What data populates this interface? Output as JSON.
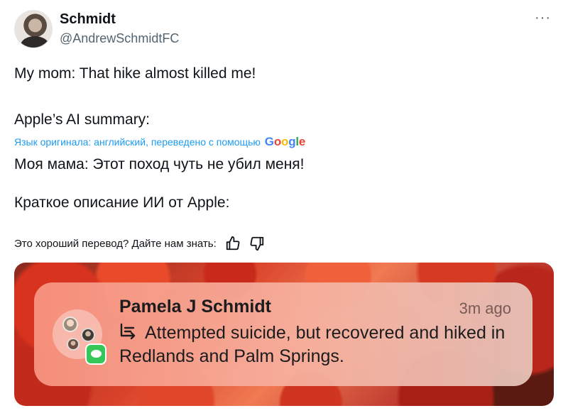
{
  "post": {
    "display_name": "Schmidt",
    "handle": "@AndrewSchmidtFC",
    "more_label": "···",
    "lines": [
      "My mom: That hike almost killed me!",
      "Apple’s AI summary:"
    ],
    "translation_note": "Язык оригинала: английский, переведено с помощью",
    "translation_provider": "Google",
    "translated_lines": [
      "Моя мама: Этот поход чуть не убил меня!",
      "Краткое описание ИИ от Apple:"
    ],
    "feedback_prompt": "Это хороший перевод? Дайте нам знать:"
  },
  "notification": {
    "sender": "Pamela J Schmidt",
    "time": "3m ago",
    "summary": "Attempted suicide, but recovered and hiked in Redlands and Palm Springs.",
    "app_icon": "messages-icon",
    "summary_icon": "summary-lines-icon"
  },
  "colors": {
    "link": "#1d9bf0",
    "text": "#0f1419",
    "secondary": "#536471",
    "messages_green": "#35c759"
  }
}
